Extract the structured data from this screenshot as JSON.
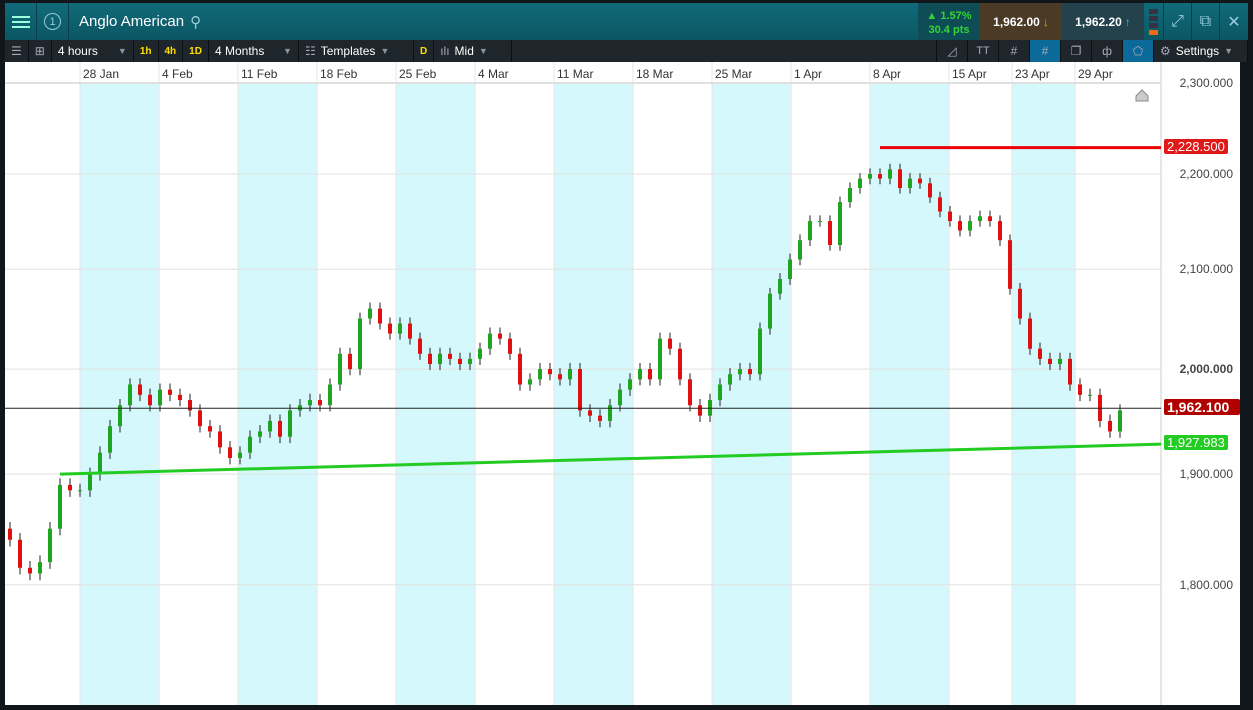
{
  "header": {
    "title": "Anglo American",
    "badge": "1",
    "change_pct": "▲ 1.57%",
    "change_pts": "30.4 pts",
    "sell": "1,962.00",
    "buy": "1,962.20"
  },
  "toolbar": {
    "interval": "4 hours",
    "q1": "1h",
    "q2": "4h",
    "q3": "1D",
    "range": "4 Months",
    "templates": "Templates",
    "d": "D",
    "price_type": "Mid",
    "settings": "Settings"
  },
  "chart_data": {
    "type": "candlestick",
    "instrument": "Anglo American",
    "x_ticks": [
      "28 Jan",
      "4 Feb",
      "11 Feb",
      "18 Feb",
      "25 Feb",
      "4 Mar",
      "11 Mar",
      "18 Mar",
      "25 Mar",
      "1 Apr",
      "8 Apr",
      "15 Apr",
      "23 Apr",
      "29 Apr"
    ],
    "y_ticks": [
      "2,300.000",
      "2,200.000",
      "2,100.000",
      "2,000.000",
      "1,900.000",
      "1,800.000"
    ],
    "ylim": [
      1700,
      2300
    ],
    "closes": [
      1840,
      1815,
      1810,
      1820,
      1850,
      1890,
      1885,
      1885,
      1900,
      1920,
      1945,
      1965,
      1985,
      1975,
      1965,
      1980,
      1975,
      1970,
      1960,
      1945,
      1940,
      1925,
      1915,
      1920,
      1935,
      1940,
      1950,
      1935,
      1960,
      1965,
      1970,
      1965,
      1985,
      2015,
      2000,
      2050,
      2060,
      2045,
      2035,
      2045,
      2030,
      2015,
      2005,
      2015,
      2010,
      2005,
      2010,
      2020,
      2035,
      2030,
      2015,
      1985,
      1990,
      2000,
      1995,
      1990,
      2000,
      1960,
      1955,
      1950,
      1965,
      1980,
      1990,
      2000,
      1990,
      2030,
      2020,
      1990,
      1965,
      1955,
      1970,
      1985,
      1995,
      2000,
      1995,
      2040,
      2075,
      2090,
      2110,
      2130,
      2150,
      2150,
      2125,
      2170,
      2185,
      2195,
      2200,
      2195,
      2205,
      2185,
      2195,
      2190,
      2175,
      2160,
      2150,
      2140,
      2150,
      2155,
      2150,
      2130,
      2080,
      2050,
      2020,
      2010,
      2005,
      2010,
      1985,
      1975,
      1975,
      1950,
      1940,
      1960
    ],
    "resistance": {
      "value": 2228.5,
      "label": "2,228.500"
    },
    "current": {
      "value": 1962.1,
      "label": "1,962.100"
    },
    "support": {
      "from": 1900,
      "to": 1927.983,
      "label": "1,927.983"
    },
    "colors": {
      "up": "#1fa51f",
      "down": "#e01010",
      "shade": "#d4f8fb"
    }
  }
}
